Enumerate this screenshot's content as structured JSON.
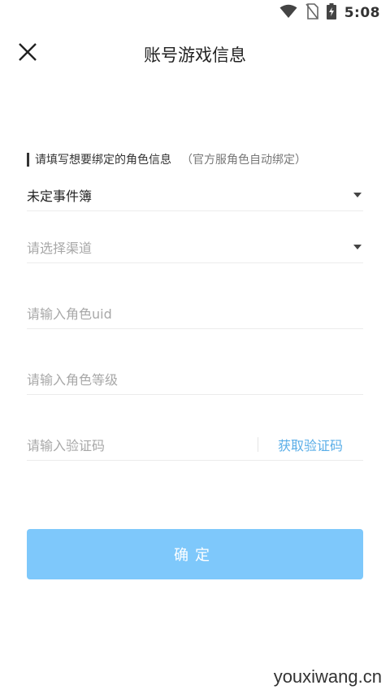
{
  "status_bar": {
    "time": "5:08"
  },
  "header": {
    "title": "账号游戏信息"
  },
  "form": {
    "hint": "请填写想要绑定的角色信息",
    "hint_note": "（官方服角色自动绑定）",
    "server_value": "未定事件簿",
    "channel_placeholder": "请选择渠道",
    "uid_placeholder": "请输入角色uid",
    "level_placeholder": "请输入角色等级",
    "code_placeholder": "请输入验证码",
    "get_code_label": "获取验证码"
  },
  "confirm_label": "确定",
  "watermark": "youxiwang.cn",
  "colors": {
    "accent": "#7ec8fb",
    "link": "#5aaee8"
  }
}
